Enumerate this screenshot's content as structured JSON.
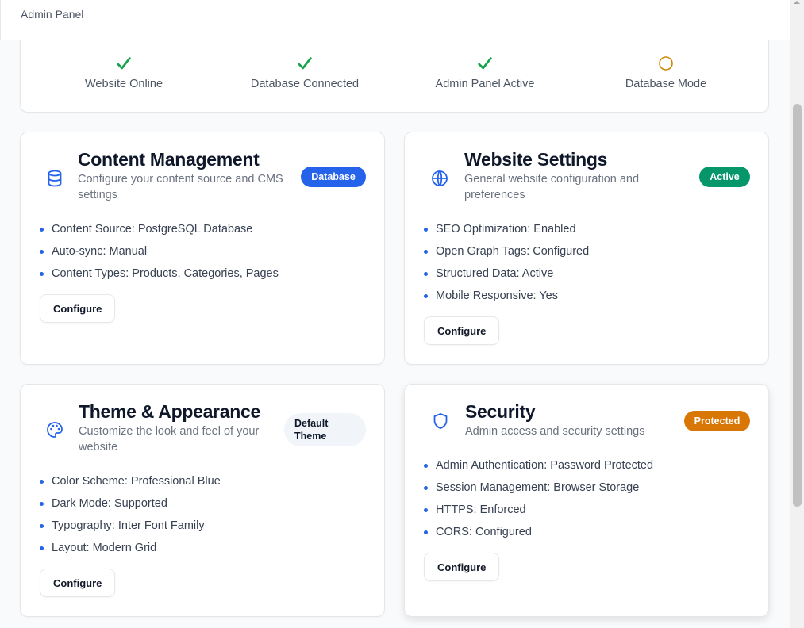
{
  "header": {
    "title": "Admin Panel"
  },
  "status": [
    {
      "label": "Website Online",
      "state": "ok"
    },
    {
      "label": "Database Connected",
      "state": "ok"
    },
    {
      "label": "Admin Panel Active",
      "state": "ok"
    },
    {
      "label": "Database Mode",
      "state": "pending"
    }
  ],
  "colors": {
    "ok": "#16a34a",
    "pending": "#ca8a04",
    "accent": "#2563eb",
    "success": "#059669",
    "warning": "#d97706"
  },
  "cards": [
    {
      "title": "Content Management",
      "description": "Configure your content source and CMS settings",
      "icon": "database-icon",
      "badge": "Database",
      "items": [
        "Content Source: PostgreSQL Database",
        "Auto-sync: Manual",
        "Content Types: Products, Categories, Pages"
      ],
      "button": "Configure"
    },
    {
      "title": "Website Settings",
      "description": "General website configuration and preferences",
      "icon": "globe-icon",
      "badge": "Active",
      "items": [
        "SEO Optimization: Enabled",
        "Open Graph Tags: Configured",
        "Structured Data: Active",
        "Mobile Responsive: Yes"
      ],
      "button": "Configure"
    },
    {
      "title": "Theme & Appearance",
      "description": "Customize the look and feel of your website",
      "icon": "palette-icon",
      "badge": "Default Theme",
      "items": [
        "Color Scheme: Professional Blue",
        "Dark Mode: Supported",
        "Typography: Inter Font Family",
        "Layout: Modern Grid"
      ],
      "button": "Configure"
    },
    {
      "title": "Security",
      "description": "Admin access and security settings",
      "icon": "shield-icon",
      "badge": "Protected",
      "items": [
        "Admin Authentication: Password Protected",
        "Session Management: Browser Storage",
        "HTTPS: Enforced",
        "CORS: Configured"
      ],
      "button": "Configure"
    }
  ]
}
